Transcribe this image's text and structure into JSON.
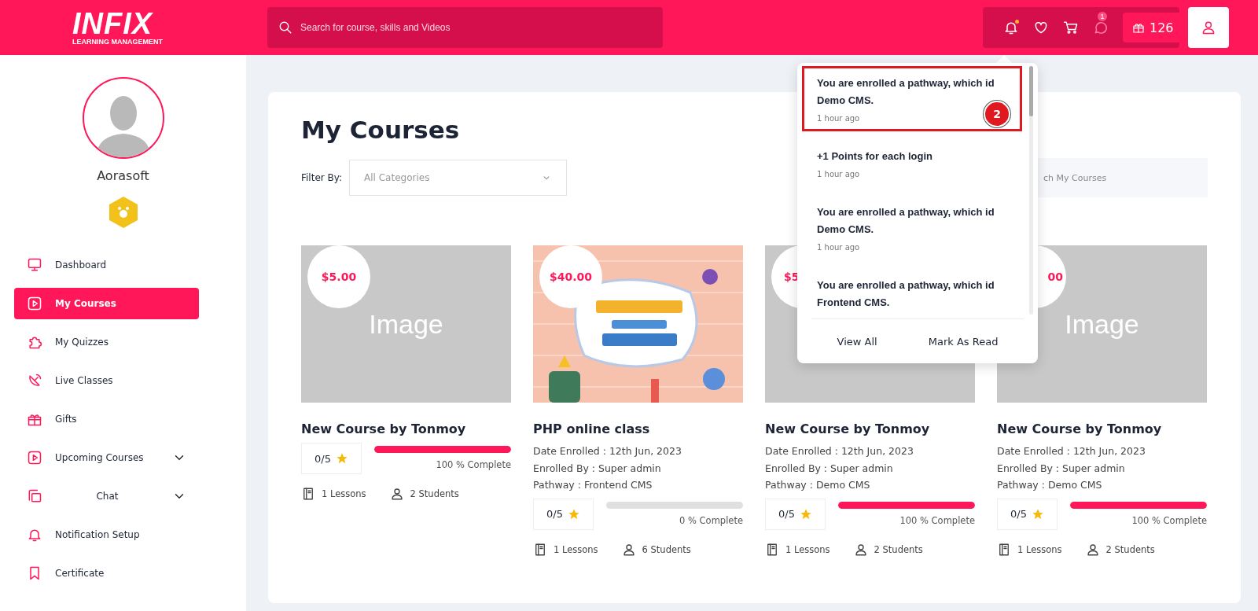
{
  "header": {
    "logo": "INFIX",
    "logo_sub": "LEARNING MANAGEMENT",
    "search": {
      "placeholder": "Search for course, skills and Videos"
    },
    "chat_badge": "1",
    "points": "126"
  },
  "sidebar": {
    "user_name": "Aorasoft",
    "items": [
      {
        "label": "Dashboard",
        "selected": false
      },
      {
        "label": "My Courses",
        "selected": true
      },
      {
        "label": "My Quizzes",
        "selected": false
      },
      {
        "label": "Live Classes",
        "selected": false
      },
      {
        "label": "Gifts",
        "selected": false
      },
      {
        "label": "Upcoming Courses",
        "selected": false,
        "expandable": true
      },
      {
        "label": "Chat",
        "selected": false,
        "expandable": true,
        "centered": true
      },
      {
        "label": "Notification Setup",
        "selected": false
      },
      {
        "label": "Certificate",
        "selected": false
      }
    ]
  },
  "main": {
    "title": "My Courses",
    "filter_label": "Filter By:",
    "filter_value": "All Categories",
    "search_visible": "ch My Courses",
    "courses": [
      {
        "price": {
          "text": "$5.00"
        },
        "image": {
          "kind": "placeholder",
          "text": "Image"
        },
        "title": "New Course by Tonmoy",
        "rating": "0/5",
        "level": 1,
        "progress": "100 % Complete",
        "lessons": "1 Lessons",
        "students": "2 Students"
      },
      {
        "price": {
          "text": "$40.00"
        },
        "image": {
          "kind": "picture"
        },
        "title": "PHP online class",
        "details": [
          "Date Enrolled : 12th Jun, 2023",
          "Enrolled By : Super admin",
          "Pathway : Frontend CMS"
        ],
        "rating": "0/5",
        "level": 0,
        "progress": "0 % Complete",
        "lessons": "1 Lessons",
        "students": "6 Students"
      },
      {
        "price": {
          "text": "$5",
          "kind": "covered-right"
        },
        "image": {
          "kind": "placeholder"
        },
        "title": "New Course by Tonmoy",
        "details": [
          "Date Enrolled : 12th Jun, 2023",
          "Enrolled By : Super admin",
          "Pathway : Demo CMS"
        ],
        "rating": "0/5",
        "level": 1,
        "progress": "100 % Complete",
        "lessons": "1 Lessons",
        "students": "2 Students"
      },
      {
        "price": {
          "text": "00",
          "kind": "covered-left"
        },
        "image": {
          "kind": "placeholder",
          "text": "Image"
        },
        "title": "New Course by Tonmoy",
        "details": [
          "Date Enrolled : 12th Jun, 2023",
          "Enrolled By : Super admin",
          "Pathway : Demo CMS"
        ],
        "rating": "0/5",
        "level": 1,
        "progress": "100 % Complete",
        "lessons": "1 Lessons",
        "students": "2 Students"
      }
    ]
  },
  "notifications": {
    "items": [
      {
        "text": "You are enrolled a pathway, which id Demo CMS.",
        "time": "1 hour ago",
        "highlighted": true,
        "step": "2"
      },
      {
        "text": "+1 Points for each login",
        "time": "1 hour ago",
        "highlighted": false
      },
      {
        "text": "You are enrolled a pathway, which id Demo CMS.",
        "time": "1 hour ago",
        "highlighted": false
      },
      {
        "text": "You are enrolled a pathway, which id Frontend CMS.",
        "highlighted": false
      }
    ],
    "actions": [
      "View All",
      "Mark As Read"
    ]
  }
}
